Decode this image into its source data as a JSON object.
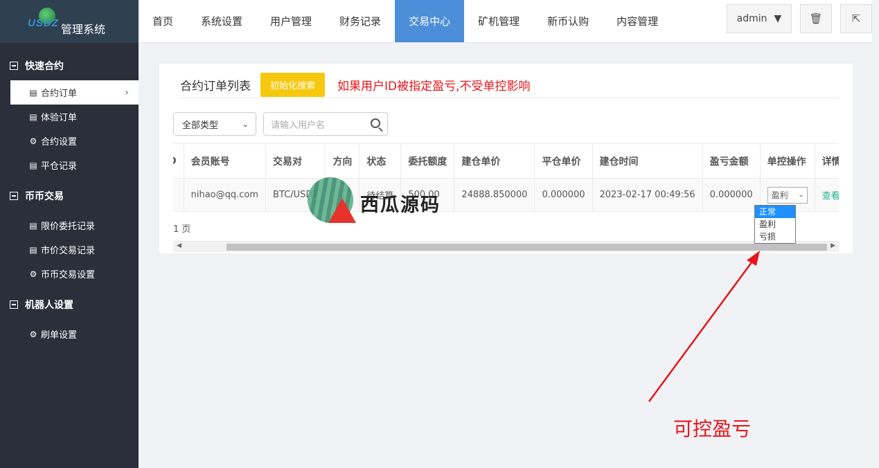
{
  "logo": {
    "mark_text": "USDZ",
    "title": "管理系统"
  },
  "sidebar": {
    "groups": [
      {
        "label": "快速合约",
        "items": [
          {
            "label": "合约订单",
            "icon": "list-icon"
          },
          {
            "label": "体验订单",
            "icon": "list-icon"
          },
          {
            "label": "合约设置",
            "icon": "gear-icon"
          },
          {
            "label": "平仓记录",
            "icon": "list-icon"
          }
        ]
      },
      {
        "label": "币币交易",
        "items": [
          {
            "label": "限价委托记录",
            "icon": "list-icon"
          },
          {
            "label": "市价交易记录",
            "icon": "list-icon"
          },
          {
            "label": "币币交易设置",
            "icon": "gear-icon"
          }
        ]
      },
      {
        "label": "机器人设置",
        "items": [
          {
            "label": "刷单设置",
            "icon": "gear-icon"
          }
        ]
      }
    ]
  },
  "topnav": {
    "items": [
      "首页",
      "系统设置",
      "用户管理",
      "财务记录",
      "交易中心",
      "矿机管理",
      "新币认购",
      "内容管理"
    ],
    "active": "交易中心",
    "user": "admin"
  },
  "panel": {
    "title": "合约订单列表",
    "init_button": "初始化搜索",
    "warning": "如果用户ID被指定盈亏,不受单控影响",
    "type_filter": "全部类型",
    "search_placeholder": "请输入用户名"
  },
  "table": {
    "headers": [
      "D",
      "会员账号",
      "交易对",
      "方向",
      "状态",
      "委托额度",
      "建仓单价",
      "平仓单价",
      "建仓时间",
      "盈亏金额",
      "单控操作",
      "详情"
    ],
    "row": {
      "id": "",
      "account": "nihao@qq.com",
      "pair": "BTC/USDT",
      "direction": "",
      "status": "待结算",
      "amount": "500.00",
      "open_price": "24888.850000",
      "close_price": "0.000000",
      "open_time": "2023-02-17 00:49:56",
      "pnl": "0.000000",
      "control_value": "盈利",
      "detail": "查看"
    }
  },
  "dropdown_options": [
    "正常",
    "盈利",
    "亏损"
  ],
  "pager_text": "1 页",
  "watermark": "西瓜源码",
  "annotation": "可控盈亏",
  "colors": {
    "accent": "#4d8ed8",
    "warning": "#e4161b",
    "button": "#f6c80f",
    "link": "#1ab394"
  }
}
